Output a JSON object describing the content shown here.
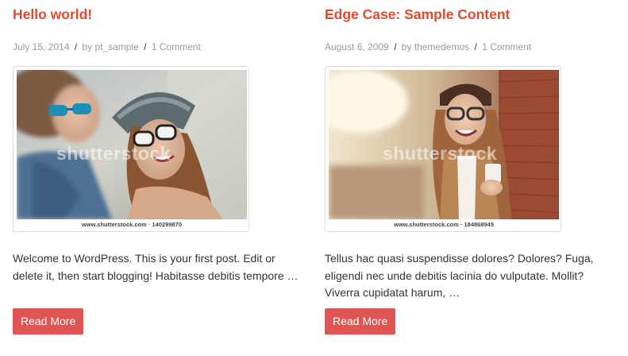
{
  "posts": [
    {
      "title": "Hello world!",
      "date": "July 15, 2014",
      "sep": "/",
      "by": "by",
      "author": "pt_sample",
      "comments": "1 Comment",
      "watermark": "shutterstock",
      "stock_caption": "www.shutterstock.com · 140299870",
      "excerpt": "Welcome to WordPress. This is your first post. Edit or delete it, then start blogging! Habitasse debitis tempore …",
      "button": "Read More"
    },
    {
      "title": "Edge Case: Sample Content",
      "date": "August 6, 2009",
      "sep": "/",
      "by": "by",
      "author": "themedemos",
      "comments": "1 Comment",
      "watermark": "shutterstock",
      "stock_caption": "www.shutterstock.com · 184868945",
      "excerpt": "Tellus hac quasi suspendisse dolores? Dolores? Fuga, eligendi nec unde debitis lacinia do vulputate. Mollit? Viverra cupidatat harum, …",
      "button": "Read More"
    }
  ],
  "colors": {
    "accent": "#e8472a",
    "button": "#e05551",
    "meta": "#9a9a9a",
    "text": "#333333"
  }
}
